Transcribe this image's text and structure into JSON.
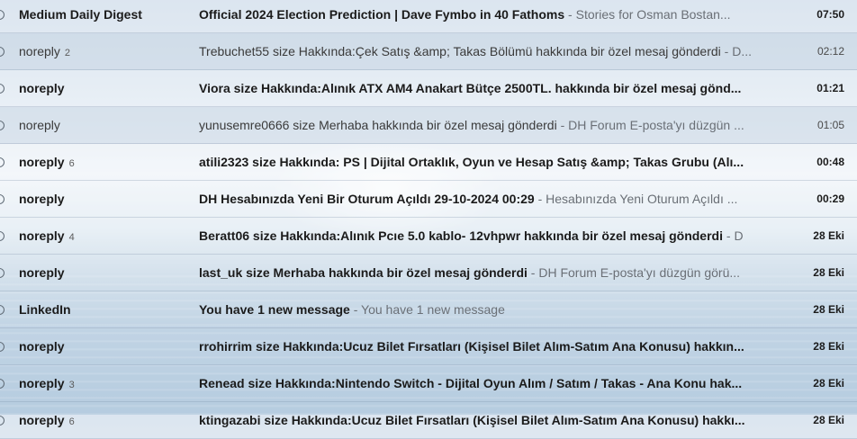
{
  "emails": [
    {
      "sender": "Medium Daily Digest",
      "count": "",
      "subject": "Official 2024 Election Prediction | Dave Fymbo in 40 Fathoms",
      "snippet": "Stories for Osman Bostan...",
      "date": "07:50",
      "unread": true
    },
    {
      "sender": "noreply",
      "count": "2",
      "subject": "Trebuchet55 size Hakkında:Çek Satış &amp; Takas Bölümü hakkında bir özel mesaj gönderdi",
      "snippet": "D...",
      "date": "02:12",
      "unread": false
    },
    {
      "sender": "noreply",
      "count": "",
      "subject": "Viora size Hakkında:Alınık ATX AM4 Anakart Bütçe 2500TL. hakkında bir özel mesaj gönd...",
      "snippet": "",
      "date": "01:21",
      "unread": true
    },
    {
      "sender": "noreply",
      "count": "",
      "subject": "yunusemre0666 size Merhaba hakkında bir özel mesaj gönderdi",
      "snippet": "DH Forum E-posta'yı düzgün ...",
      "date": "01:05",
      "unread": false
    },
    {
      "sender": "noreply",
      "count": "6",
      "subject": "atili2323 size Hakkında: PS | Dijital Ortaklık, Oyun ve Hesap Satış &amp; Takas Grubu (Alı...",
      "snippet": "",
      "date": "00:48",
      "unread": true
    },
    {
      "sender": "noreply",
      "count": "",
      "subject": "DH Hesabınızda Yeni Bir Oturum Açıldı 29-10-2024 00:29",
      "snippet": "Hesabınızda Yeni Oturum Açıldı ...",
      "date": "00:29",
      "unread": true
    },
    {
      "sender": "noreply",
      "count": "4",
      "subject": "Beratt06 size Hakkında:Alınık Pcıe 5.0 kablo- 12vhpwr hakkında bir özel mesaj gönderdi",
      "snippet": "D",
      "date": "28 Eki",
      "unread": true
    },
    {
      "sender": "noreply",
      "count": "",
      "subject": "last_uk size Merhaba hakkında bir özel mesaj gönderdi",
      "snippet": "DH Forum E-posta'yı düzgün görü...",
      "date": "28 Eki",
      "unread": true
    },
    {
      "sender": "LinkedIn",
      "count": "",
      "subject": "You have 1 new message",
      "snippet": "You have 1 new message",
      "date": "28 Eki",
      "unread": true
    },
    {
      "sender": "noreply",
      "count": "",
      "subject": "rrohirrim size Hakkında:Ucuz Bilet Fırsatları (Kişisel Bilet Alım-Satım Ana Konusu) hakkın...",
      "snippet": "",
      "date": "28 Eki",
      "unread": true
    },
    {
      "sender": "noreply",
      "count": "3",
      "subject": "Renead size Hakkında:Nintendo Switch - Dijital Oyun Alım / Satım / Takas - Ana Konu hak...",
      "snippet": "",
      "date": "28 Eki",
      "unread": true
    },
    {
      "sender": "noreply",
      "count": "6",
      "subject": "ktingazabi size Hakkında:Ucuz Bilet Fırsatları (Kişisel Bilet Alım-Satım Ana Konusu) hakkı...",
      "snippet": "",
      "date": "28 Eki",
      "unread": true
    }
  ],
  "separator": " - "
}
